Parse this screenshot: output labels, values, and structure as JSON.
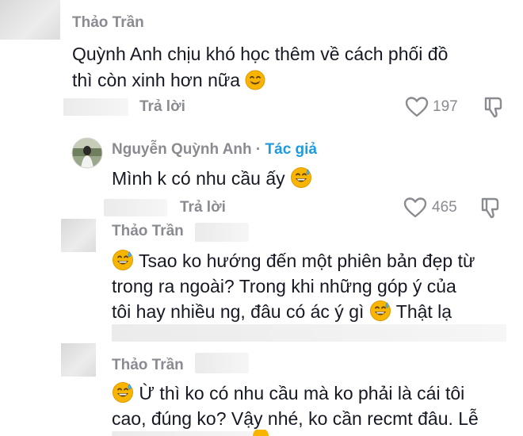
{
  "comments": [
    {
      "username": "Thảo Trần",
      "text_line1": "Quỳnh Anh chịu khó học thêm về cách phối đồ",
      "text_line2": "thì còn xinh hơn nữa",
      "reply_label": "Trả lời",
      "likes": "197"
    },
    {
      "username": "Nguyễn Quỳnh Anh",
      "separator": "·",
      "author_tag": "Tác giả",
      "text": "Mình k có nhu cầu ấy",
      "reply_label": "Trả lời",
      "likes": "465"
    },
    {
      "username": "Thảo Trần",
      "text_line1": "Tsao ko hướng đến một phiên bản đẹp từ",
      "text_line2": "trong ra ngoài? Trong khi những góp ý của",
      "text_line3": "tôi hay nhiều ng, đâu có ác ý gì",
      "text_line3_end": "Thật lạ"
    },
    {
      "username": "Thảo Trần",
      "text_line1": "Ừ thì ko có nhu cầu mà ko phải là cái tôi",
      "text_line2": "cao, đúng ko? Vậy nhé, ko cần recmt đâu. Lễ"
    }
  ],
  "icons": {
    "like": "heart-outline-icon",
    "dislike": "thumbs-down-icon",
    "emoji_smile": "smiling-face-emoji",
    "emoji_sweat": "grinning-face-with-sweat-emoji"
  },
  "colors": {
    "username": "#8a8b91",
    "author_tag": "#1e9be0",
    "text": "#161823",
    "emoji": "#f7b500"
  }
}
